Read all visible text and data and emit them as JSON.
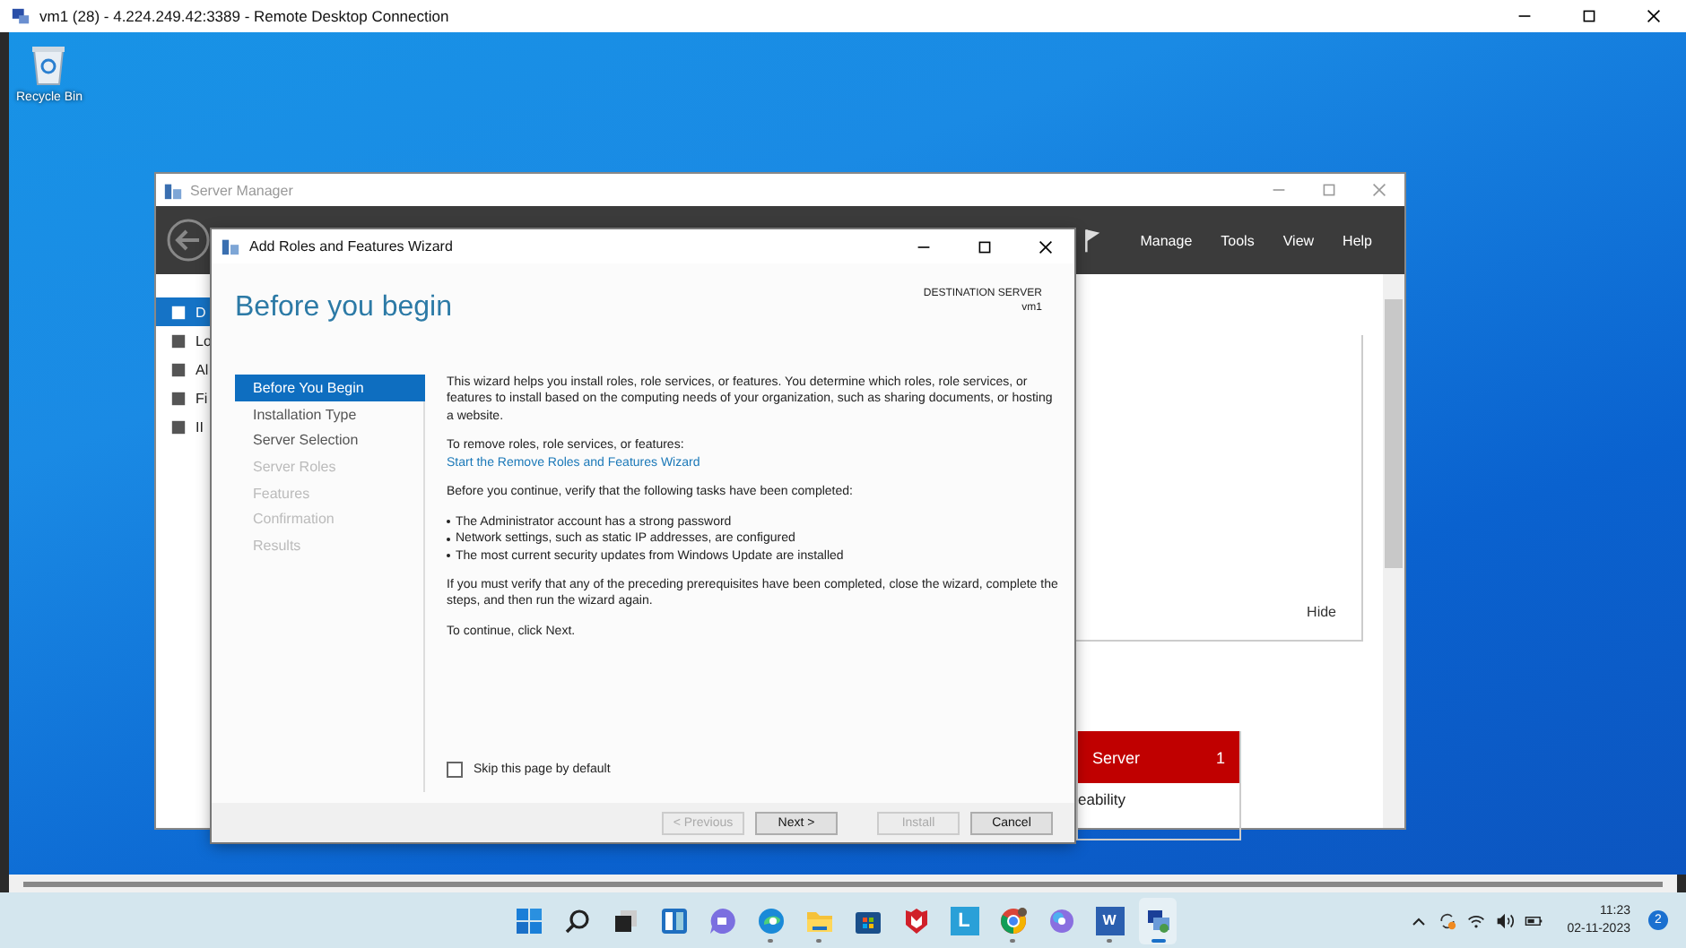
{
  "rdp_window": {
    "title": "vm1 (28) - 4.224.249.42:3389 - Remote Desktop Connection"
  },
  "desktop_icons": [
    {
      "label": "Recycle Bin"
    }
  ],
  "server_manager": {
    "title": "Server Manager",
    "menu": [
      "Manage",
      "Tools",
      "View",
      "Help"
    ],
    "nav_items": [
      {
        "label": "D",
        "selected": true
      },
      {
        "label": "Lo",
        "selected": false
      },
      {
        "label": "Al",
        "selected": false
      },
      {
        "label": "Fi",
        "selected": false
      },
      {
        "label": "II",
        "selected": false
      }
    ],
    "hide_link": "Hide",
    "tile": {
      "title": "Server",
      "count": "1",
      "row": "eability"
    }
  },
  "wizard": {
    "title": "Add Roles and Features Wizard",
    "heading": "Before you begin",
    "destination_label": "DESTINATION SERVER",
    "destination_value": "vm1",
    "steps": [
      {
        "label": "Before You Begin",
        "selected": true,
        "disabled": false
      },
      {
        "label": "Installation Type",
        "selected": false,
        "disabled": false
      },
      {
        "label": "Server Selection",
        "selected": false,
        "disabled": false
      },
      {
        "label": "Server Roles",
        "selected": false,
        "disabled": true
      },
      {
        "label": "Features",
        "selected": false,
        "disabled": true
      },
      {
        "label": "Confirmation",
        "selected": false,
        "disabled": true
      },
      {
        "label": "Results",
        "selected": false,
        "disabled": true
      }
    ],
    "intro": "This wizard helps you install roles, role services, or features. You determine which roles, role services, or features to install based on the computing needs of your organization, such as sharing documents, or hosting a website.",
    "remove_label": "To remove roles, role services, or features:",
    "remove_link": "Start the Remove Roles and Features Wizard",
    "verify_text": "Before you continue, verify that the following tasks have been completed:",
    "tasks": [
      "The Administrator account has a strong password",
      "Network settings, such as static IP addresses, are configured",
      "The most current security updates from Windows Update are installed"
    ],
    "prereq_text": "If you must verify that any of the preceding prerequisites have been completed, close the wizard, complete the steps, and then run the wizard again.",
    "continue_text": "To continue, click Next.",
    "skip_checkbox": {
      "label": "Skip this page by default",
      "checked": false
    },
    "buttons": [
      {
        "label": "< Previous",
        "disabled": true
      },
      {
        "label": "Next >",
        "disabled": false
      },
      {
        "label": "Install",
        "disabled": true
      },
      {
        "label": "Cancel",
        "disabled": false
      }
    ]
  },
  "taskbar": {
    "apps": [
      {
        "kind": "start",
        "running": false
      },
      {
        "kind": "search",
        "running": false
      },
      {
        "kind": "taskview",
        "running": false
      },
      {
        "kind": "widgets",
        "running": false
      },
      {
        "kind": "chat",
        "running": false
      },
      {
        "kind": "edge",
        "running": true
      },
      {
        "kind": "folder",
        "running": true
      },
      {
        "kind": "store",
        "running": false
      },
      {
        "kind": "shield",
        "running": false
      },
      {
        "kind": "tile",
        "glyph": "L",
        "running": false
      },
      {
        "kind": "chrome",
        "running": true
      },
      {
        "kind": "copilot",
        "running": false
      },
      {
        "kind": "word",
        "glyph": "W",
        "running": true
      },
      {
        "kind": "rdp",
        "running": true,
        "selected": true
      }
    ],
    "time": "11:23",
    "date": "02-11-2023",
    "notification_count": "2"
  }
}
